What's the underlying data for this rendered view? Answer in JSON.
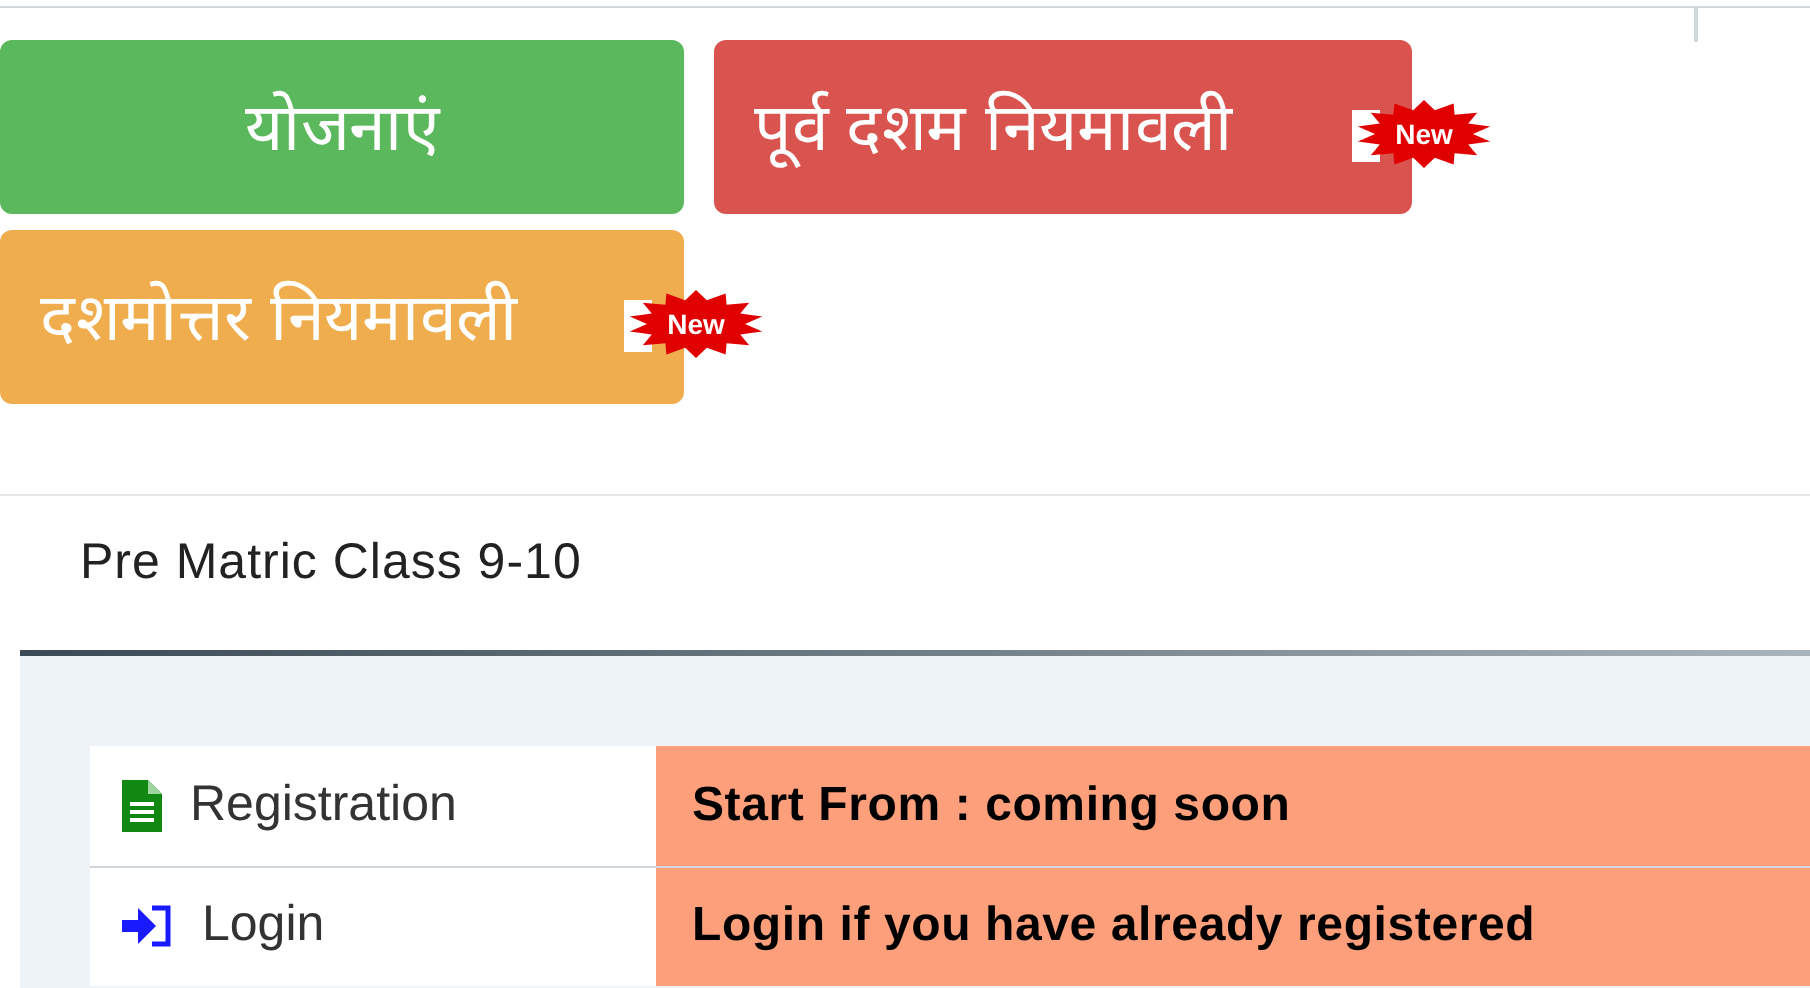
{
  "nav_buttons": [
    {
      "label": "योजनाएं",
      "color": "#5cb85c"
    },
    {
      "label": "पूर्व दशम नियमावली",
      "color": "#d9534f",
      "new_badge": "New"
    },
    {
      "label": "दशमोत्तर नियमावली",
      "color": "#f0ad4e",
      "new_badge": "New"
    }
  ],
  "section": {
    "title": "Pre Matric Class 9-10",
    "rows": [
      {
        "kind": "document",
        "label": "Registration",
        "info": "Start From : coming soon"
      },
      {
        "kind": "login",
        "label": "Login",
        "info": "Login if you have already registered"
      }
    ]
  }
}
